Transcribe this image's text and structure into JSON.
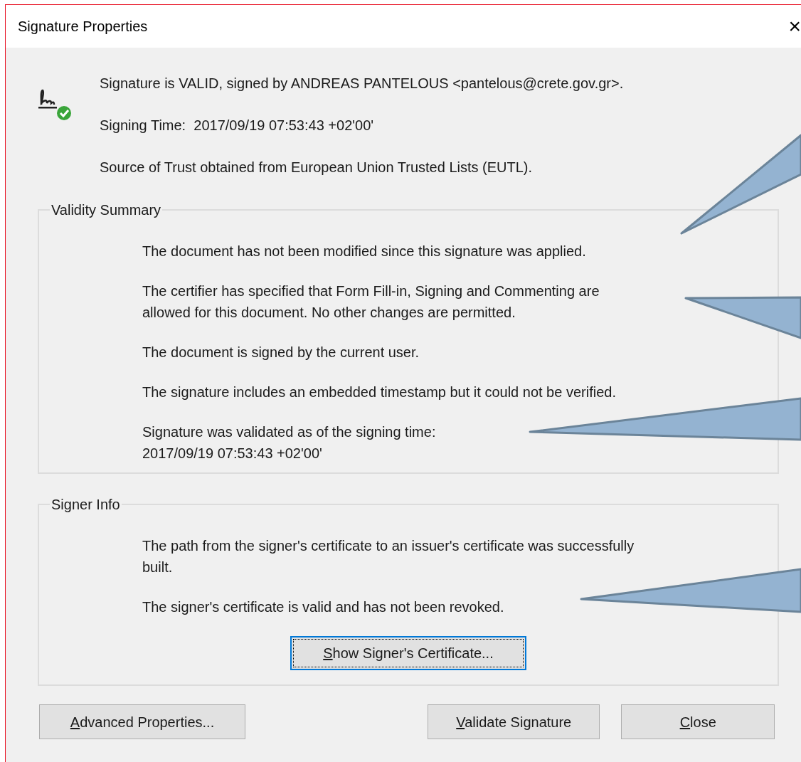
{
  "window": {
    "title": "Signature Properties",
    "close": "×"
  },
  "summary": [
    "Signature is VALID, signed by ANDREAS PANTELOUS <pantelous@crete.gov.gr>.",
    "Signing Time:  2017/09/19 07:53:43 +02'00'",
    "Source of Trust obtained from European Union Trusted Lists (EUTL)."
  ],
  "validity_summary": {
    "title": "Validity Summary",
    "lines": [
      [
        "The document has not been modified since this signature was applied."
      ],
      [
        "The certifier has specified that Form Fill-in, Signing and Commenting are",
        "allowed for this document. No other changes are permitted."
      ],
      [
        "The document is signed by the current user."
      ],
      [
        "The signature includes an embedded timestamp but it could not be verified."
      ],
      [
        "Signature was validated as of the signing time:",
        "2017/09/19 07:53:43 +02'00'"
      ]
    ]
  },
  "signer_info": {
    "title": "Signer Info",
    "lines": [
      [
        "The path from the signer's certificate to an issuer's certificate was successfully",
        "built."
      ],
      [
        "The signer's certificate is valid and has not been revoked."
      ]
    ],
    "button": {
      "label": "Show Signer's Certificate...",
      "first_letter_underlined": true,
      "focused": true
    }
  },
  "buttons": [
    {
      "label": "Advanced Properties...",
      "first_letter_underlined": true,
      "focused": false
    },
    {
      "label": "Validate Signature",
      "first_letter_underlined": true,
      "focused": false
    },
    {
      "label": "Close",
      "first_letter_underlined": true,
      "focused": false
    }
  ]
}
